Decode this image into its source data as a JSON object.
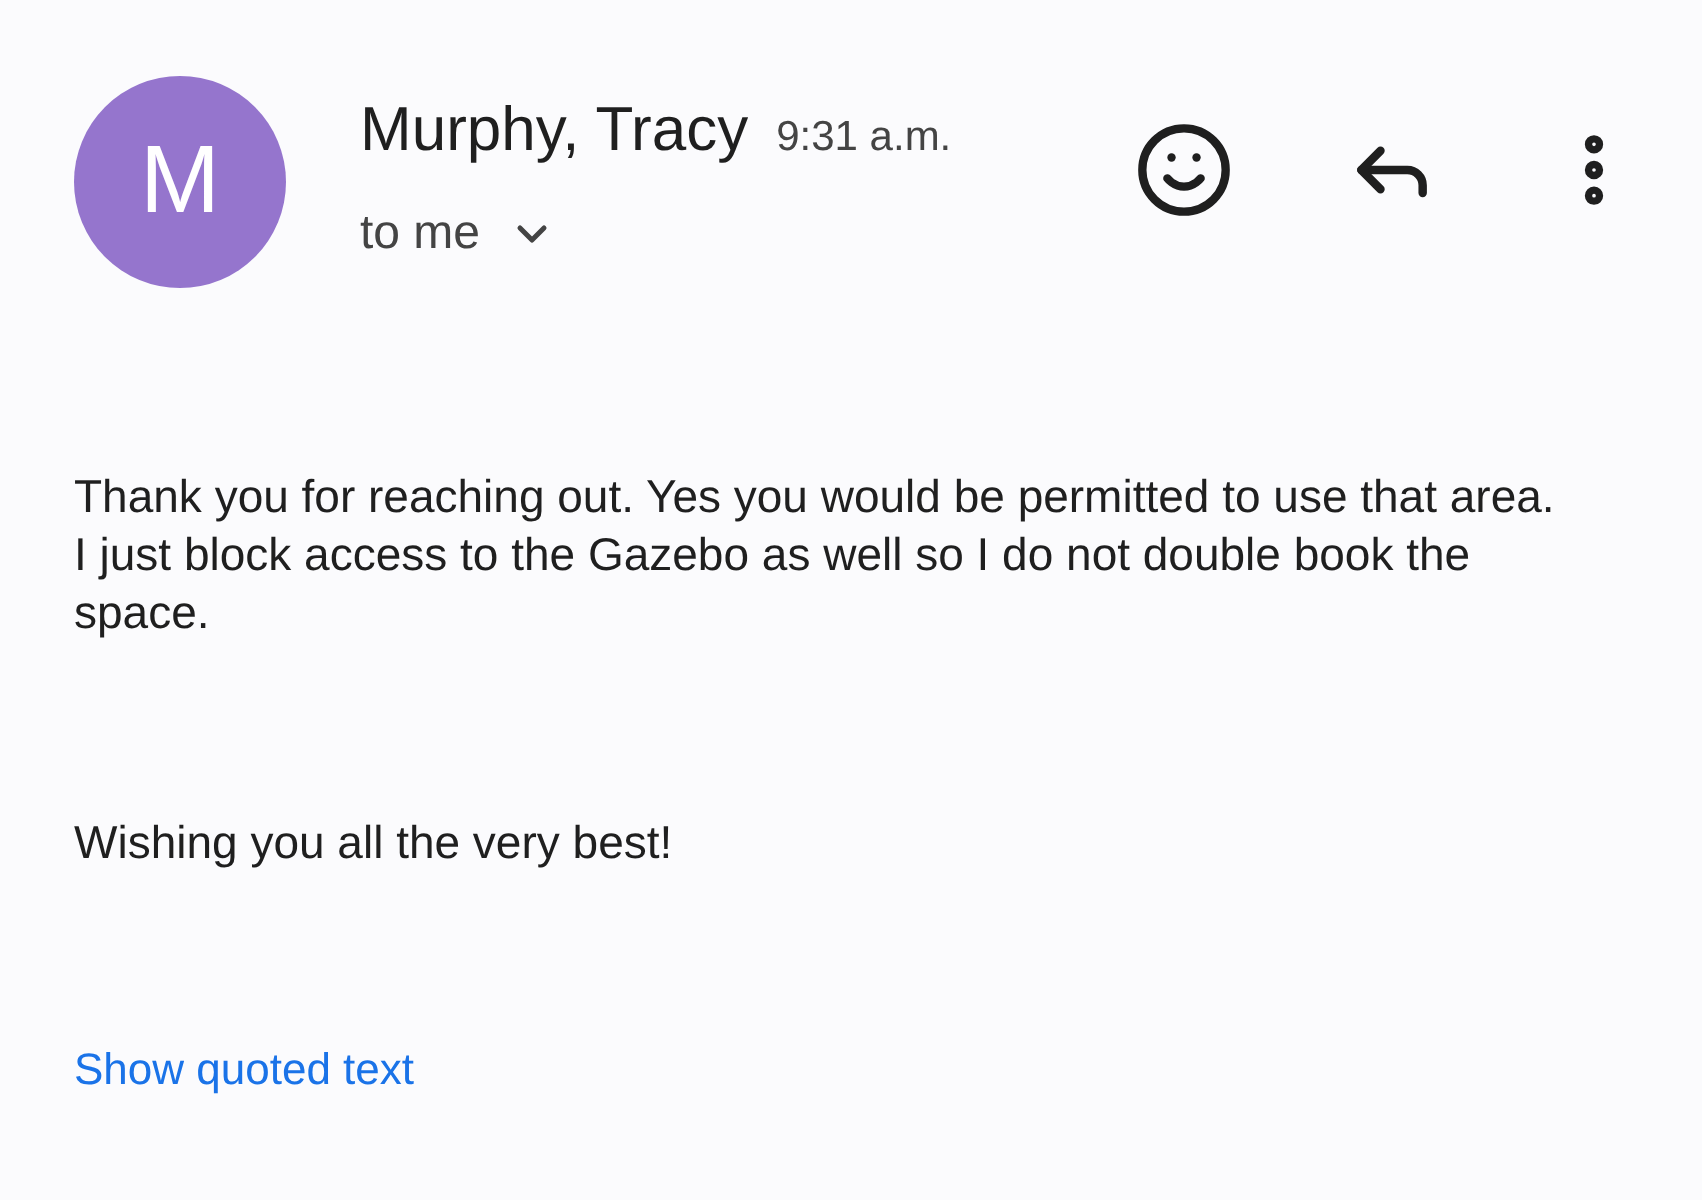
{
  "sender": {
    "initial": "M",
    "name": "Murphy, Tracy",
    "time": "9:31 a.m.",
    "recipient": "to me"
  },
  "body": [
    "Thank you for reaching out. Yes you would be permitted to use that area. I just block access to the Gazebo as well so I do not double book the space.",
    "Wishing you all the very best!"
  ],
  "quoted_link": "Show quoted text"
}
